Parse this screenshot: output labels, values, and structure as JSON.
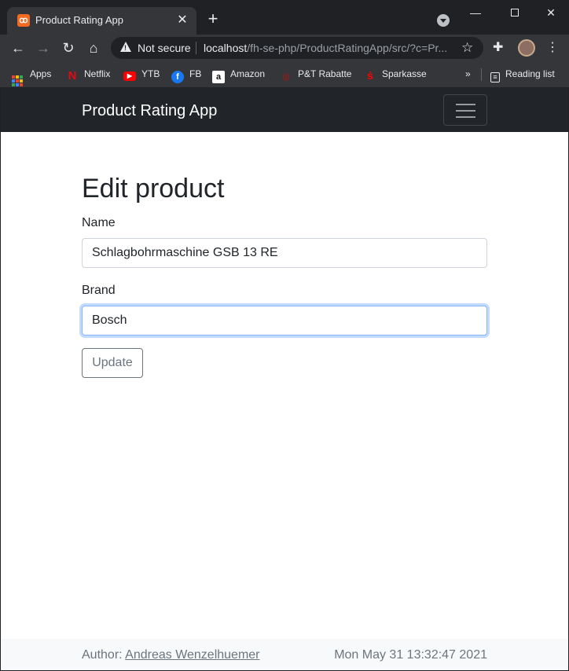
{
  "browser": {
    "tab": {
      "favicon": "xampp-icon",
      "title": "Product Rating App",
      "close_icon": "close-icon"
    },
    "new_tab_icon": "plus-icon",
    "window_controls": {
      "minimize": "—",
      "maximize": "□",
      "close": "✕"
    },
    "address_bar": {
      "security_label": "Not secure",
      "host": "localhost",
      "path": "/fh-se-php/ProductRatingApp/src/?c=Pr..."
    },
    "bookmarks": [
      {
        "label": "Apps",
        "icon": "apps-grid-icon"
      },
      {
        "label": "Netflix",
        "icon": "netflix-icon"
      },
      {
        "label": "YTB",
        "icon": "youtube-icon"
      },
      {
        "label": "FB",
        "icon": "facebook-icon"
      },
      {
        "label": "Amazon",
        "icon": "amazon-icon"
      },
      {
        "label": "P&T Rabatte",
        "icon": "pt-rabatte-icon"
      },
      {
        "label": "Sparkasse",
        "icon": "sparkasse-icon"
      }
    ],
    "bookmarks_overflow": "»",
    "reading_list": "Reading list"
  },
  "app": {
    "brand": "Product Rating App",
    "page_title": "Edit product",
    "form": {
      "name_label": "Name",
      "name_value": "Schlagbohrmaschine GSB 13 RE",
      "brand_label": "Brand",
      "brand_value": "Bosch",
      "submit_label": "Update"
    },
    "footer": {
      "author_prefix": "Author:",
      "author_name": "Andreas Wenzelhuemer",
      "timestamp": "Mon May 31 13:32:47 2021"
    }
  },
  "colors": {
    "navbar": "#212529",
    "focus_ring": "#86b7fe",
    "muted_text": "#6c757d",
    "footer_bg": "#f8f9fa"
  }
}
